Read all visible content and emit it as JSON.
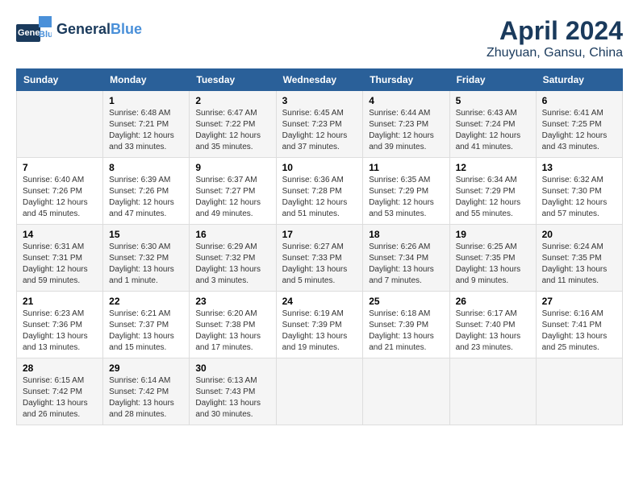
{
  "header": {
    "logo_general": "General",
    "logo_blue": "Blue",
    "title": "April 2024",
    "subtitle": "Zhuyuan, Gansu, China"
  },
  "days_of_week": [
    "Sunday",
    "Monday",
    "Tuesday",
    "Wednesday",
    "Thursday",
    "Friday",
    "Saturday"
  ],
  "weeks": [
    [
      {
        "day": "",
        "info": ""
      },
      {
        "day": "1",
        "info": "Sunrise: 6:48 AM\nSunset: 7:21 PM\nDaylight: 12 hours\nand 33 minutes."
      },
      {
        "day": "2",
        "info": "Sunrise: 6:47 AM\nSunset: 7:22 PM\nDaylight: 12 hours\nand 35 minutes."
      },
      {
        "day": "3",
        "info": "Sunrise: 6:45 AM\nSunset: 7:23 PM\nDaylight: 12 hours\nand 37 minutes."
      },
      {
        "day": "4",
        "info": "Sunrise: 6:44 AM\nSunset: 7:23 PM\nDaylight: 12 hours\nand 39 minutes."
      },
      {
        "day": "5",
        "info": "Sunrise: 6:43 AM\nSunset: 7:24 PM\nDaylight: 12 hours\nand 41 minutes."
      },
      {
        "day": "6",
        "info": "Sunrise: 6:41 AM\nSunset: 7:25 PM\nDaylight: 12 hours\nand 43 minutes."
      }
    ],
    [
      {
        "day": "7",
        "info": "Sunrise: 6:40 AM\nSunset: 7:26 PM\nDaylight: 12 hours\nand 45 minutes."
      },
      {
        "day": "8",
        "info": "Sunrise: 6:39 AM\nSunset: 7:26 PM\nDaylight: 12 hours\nand 47 minutes."
      },
      {
        "day": "9",
        "info": "Sunrise: 6:37 AM\nSunset: 7:27 PM\nDaylight: 12 hours\nand 49 minutes."
      },
      {
        "day": "10",
        "info": "Sunrise: 6:36 AM\nSunset: 7:28 PM\nDaylight: 12 hours\nand 51 minutes."
      },
      {
        "day": "11",
        "info": "Sunrise: 6:35 AM\nSunset: 7:29 PM\nDaylight: 12 hours\nand 53 minutes."
      },
      {
        "day": "12",
        "info": "Sunrise: 6:34 AM\nSunset: 7:29 PM\nDaylight: 12 hours\nand 55 minutes."
      },
      {
        "day": "13",
        "info": "Sunrise: 6:32 AM\nSunset: 7:30 PM\nDaylight: 12 hours\nand 57 minutes."
      }
    ],
    [
      {
        "day": "14",
        "info": "Sunrise: 6:31 AM\nSunset: 7:31 PM\nDaylight: 12 hours\nand 59 minutes."
      },
      {
        "day": "15",
        "info": "Sunrise: 6:30 AM\nSunset: 7:32 PM\nDaylight: 13 hours\nand 1 minute."
      },
      {
        "day": "16",
        "info": "Sunrise: 6:29 AM\nSunset: 7:32 PM\nDaylight: 13 hours\nand 3 minutes."
      },
      {
        "day": "17",
        "info": "Sunrise: 6:27 AM\nSunset: 7:33 PM\nDaylight: 13 hours\nand 5 minutes."
      },
      {
        "day": "18",
        "info": "Sunrise: 6:26 AM\nSunset: 7:34 PM\nDaylight: 13 hours\nand 7 minutes."
      },
      {
        "day": "19",
        "info": "Sunrise: 6:25 AM\nSunset: 7:35 PM\nDaylight: 13 hours\nand 9 minutes."
      },
      {
        "day": "20",
        "info": "Sunrise: 6:24 AM\nSunset: 7:35 PM\nDaylight: 13 hours\nand 11 minutes."
      }
    ],
    [
      {
        "day": "21",
        "info": "Sunrise: 6:23 AM\nSunset: 7:36 PM\nDaylight: 13 hours\nand 13 minutes."
      },
      {
        "day": "22",
        "info": "Sunrise: 6:21 AM\nSunset: 7:37 PM\nDaylight: 13 hours\nand 15 minutes."
      },
      {
        "day": "23",
        "info": "Sunrise: 6:20 AM\nSunset: 7:38 PM\nDaylight: 13 hours\nand 17 minutes."
      },
      {
        "day": "24",
        "info": "Sunrise: 6:19 AM\nSunset: 7:39 PM\nDaylight: 13 hours\nand 19 minutes."
      },
      {
        "day": "25",
        "info": "Sunrise: 6:18 AM\nSunset: 7:39 PM\nDaylight: 13 hours\nand 21 minutes."
      },
      {
        "day": "26",
        "info": "Sunrise: 6:17 AM\nSunset: 7:40 PM\nDaylight: 13 hours\nand 23 minutes."
      },
      {
        "day": "27",
        "info": "Sunrise: 6:16 AM\nSunset: 7:41 PM\nDaylight: 13 hours\nand 25 minutes."
      }
    ],
    [
      {
        "day": "28",
        "info": "Sunrise: 6:15 AM\nSunset: 7:42 PM\nDaylight: 13 hours\nand 26 minutes."
      },
      {
        "day": "29",
        "info": "Sunrise: 6:14 AM\nSunset: 7:42 PM\nDaylight: 13 hours\nand 28 minutes."
      },
      {
        "day": "30",
        "info": "Sunrise: 6:13 AM\nSunset: 7:43 PM\nDaylight: 13 hours\nand 30 minutes."
      },
      {
        "day": "",
        "info": ""
      },
      {
        "day": "",
        "info": ""
      },
      {
        "day": "",
        "info": ""
      },
      {
        "day": "",
        "info": ""
      }
    ]
  ]
}
